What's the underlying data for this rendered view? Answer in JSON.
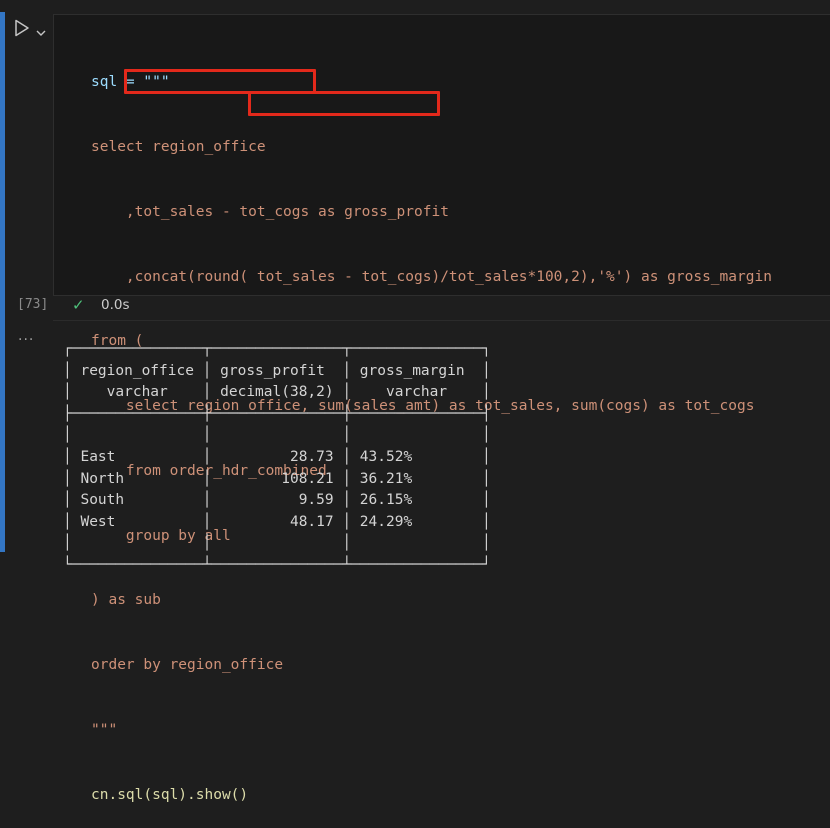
{
  "cell": {
    "execution_count": "[73]",
    "duration": "0.0s",
    "output_menu": "..."
  },
  "code_lines": [
    "sql = \"\"\"",
    "select region_office",
    "    ,tot_sales - tot_cogs as gross_profit",
    "    ,concat(round( tot_sales - tot_cogs)/tot_sales*100,2),'%') as gross_margin",
    "from (",
    "    select region_office, sum(sales_amt) as tot_sales, sum(cogs) as tot_cogs",
    "    from order_hdr_combined",
    "    group by all",
    ") as sub",
    "order by region_office",
    "\"\"\"",
    "cn.sql(sql).show()"
  ],
  "output_table": {
    "columns": [
      {
        "name": "region_office",
        "type": "varchar"
      },
      {
        "name": "gross_profit",
        "type": "decimal(38,2)"
      },
      {
        "name": "gross_margin",
        "type": "varchar"
      }
    ],
    "rows": [
      [
        "East",
        "28.73",
        "43.52%"
      ],
      [
        "North",
        "108.21",
        "36.21%"
      ],
      [
        "South",
        "9.59",
        "26.15%"
      ],
      [
        "West",
        "48.17",
        "24.29%"
      ]
    ]
  },
  "colors": {
    "cell_indicator": "#3376c4",
    "highlight_box": "#e3291b",
    "success_check": "#4ec07a"
  },
  "icons": [
    "run-icon",
    "chevron-down-icon",
    "check-icon",
    "more-icon"
  ]
}
